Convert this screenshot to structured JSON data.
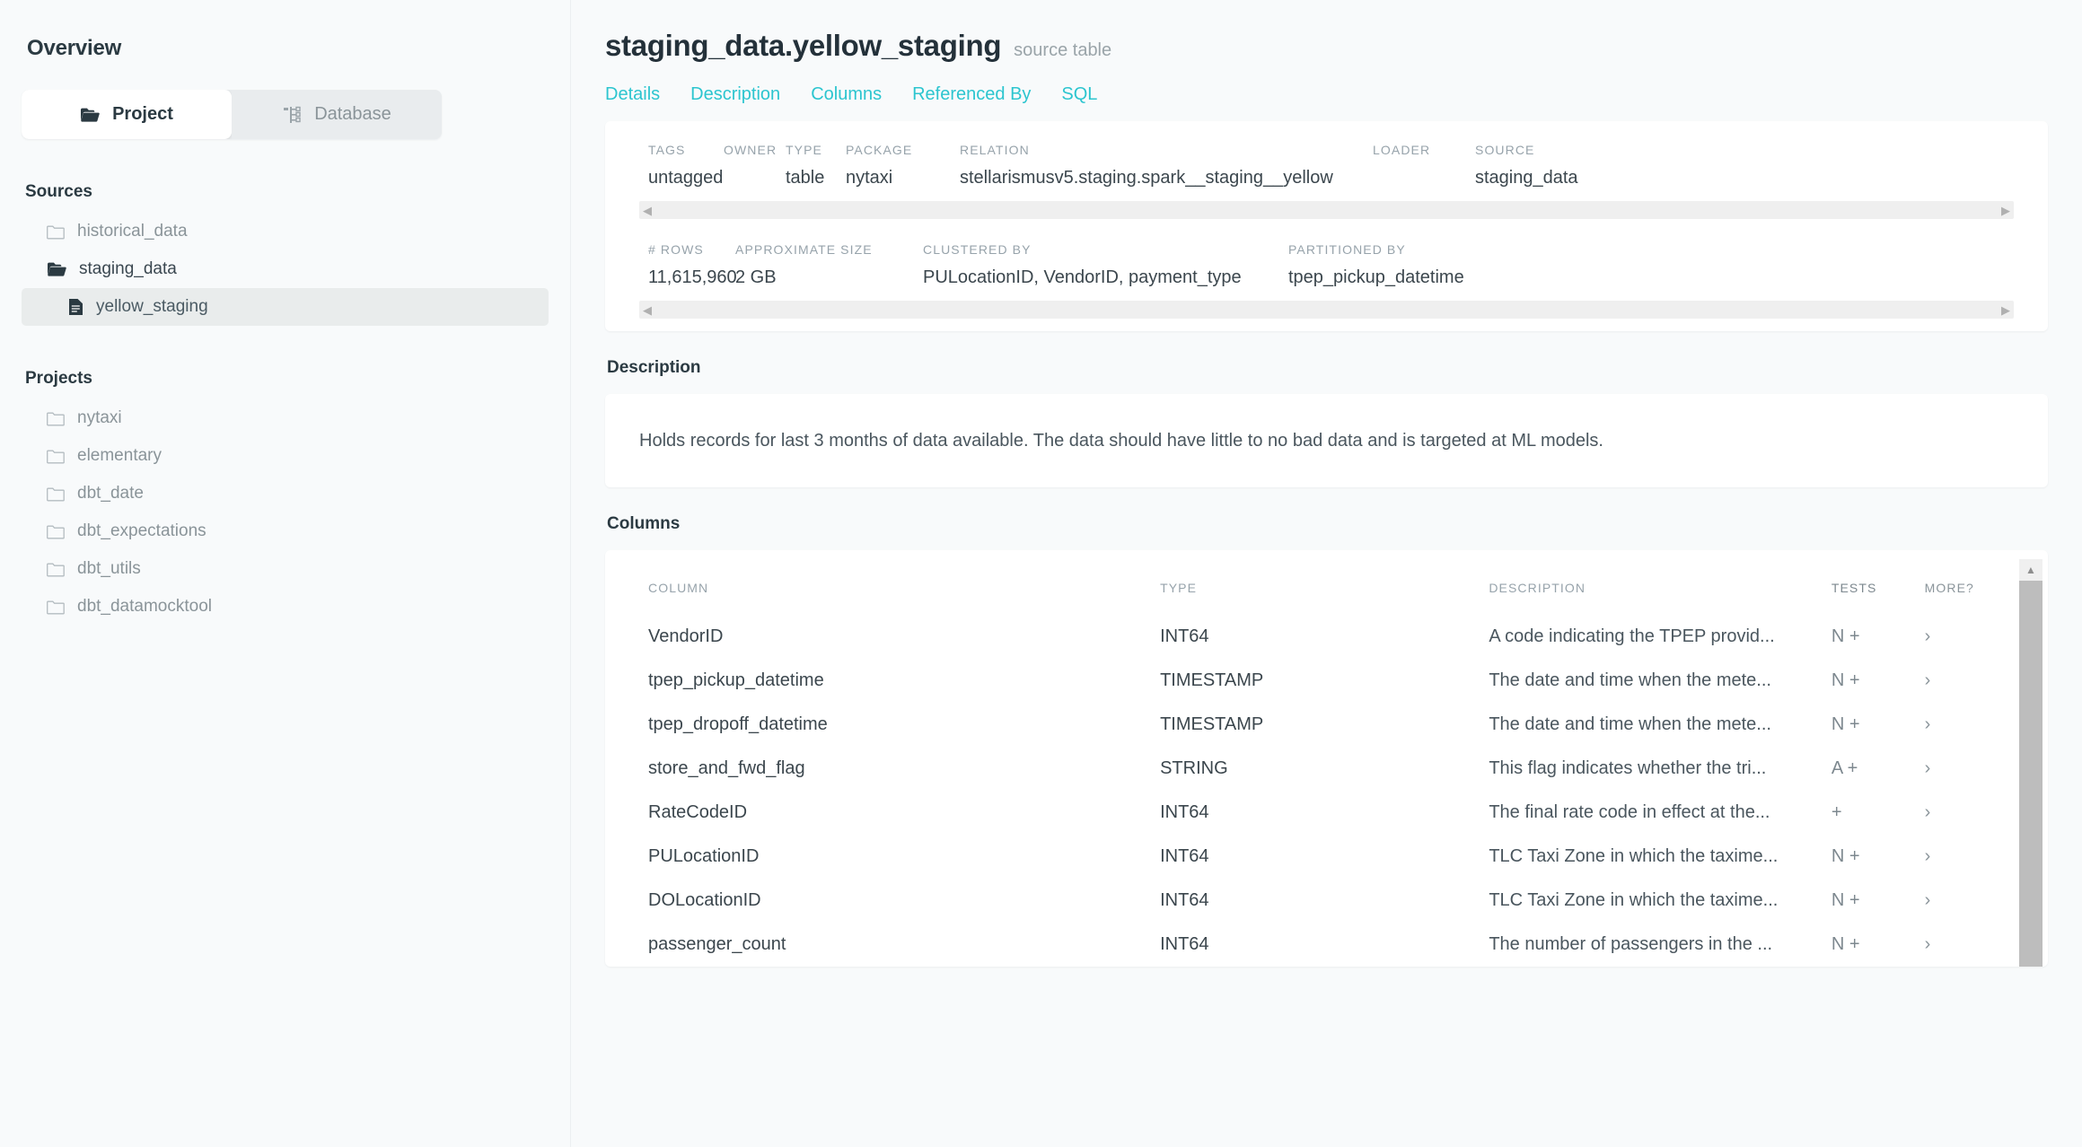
{
  "sidebar": {
    "title": "Overview",
    "switch": [
      {
        "label": "Project",
        "icon": "folder-open-icon",
        "active": true
      },
      {
        "label": "Database",
        "icon": "database-tree-icon",
        "active": false
      }
    ],
    "sources_label": "Sources",
    "sources": [
      {
        "label": "historical_data",
        "icon": "folder-closed-icon",
        "state": "closed"
      },
      {
        "label": "staging_data",
        "icon": "folder-open-icon",
        "state": "open"
      },
      {
        "label": "yellow_staging",
        "icon": "file-icon",
        "state": "selected"
      }
    ],
    "projects_label": "Projects",
    "projects": [
      {
        "label": "nytaxi",
        "icon": "folder-closed-icon"
      },
      {
        "label": "elementary",
        "icon": "folder-closed-icon"
      },
      {
        "label": "dbt_date",
        "icon": "folder-closed-icon"
      },
      {
        "label": "dbt_expectations",
        "icon": "folder-closed-icon"
      },
      {
        "label": "dbt_utils",
        "icon": "folder-closed-icon"
      },
      {
        "label": "dbt_datamocktool",
        "icon": "folder-closed-icon"
      }
    ]
  },
  "header": {
    "title": "staging_data.yellow_staging",
    "subtitle": "source table",
    "tabs": [
      {
        "label": "Details"
      },
      {
        "label": "Description"
      },
      {
        "label": "Columns"
      },
      {
        "label": "Referenced By"
      },
      {
        "label": "SQL"
      }
    ]
  },
  "details": {
    "row1": [
      {
        "key": "TAGS",
        "value": "untagged"
      },
      {
        "key": "OWNER",
        "value": ""
      },
      {
        "key": "TYPE",
        "value": "table"
      },
      {
        "key": "PACKAGE",
        "value": "nytaxi"
      },
      {
        "key": "RELATION",
        "value": "stellarismusv5.staging.spark__staging__yellow"
      },
      {
        "key": "LOADER",
        "value": ""
      },
      {
        "key": "SOURCE",
        "value": "staging_data"
      }
    ],
    "row2": [
      {
        "key": "# ROWS",
        "value": "11,615,960"
      },
      {
        "key": "APPROXIMATE SIZE",
        "value": "2 GB"
      },
      {
        "key": "CLUSTERED BY",
        "value": "PULocationID, VendorID, payment_type"
      },
      {
        "key": "PARTITIONED BY",
        "value": "tpep_pickup_datetime"
      }
    ],
    "scroll_left_icon": "caret-left-icon",
    "scroll_right_icon": "caret-right-icon"
  },
  "description": {
    "heading": "Description",
    "text": "Holds records for last 3 months of data available. The data should have little to no bad data and is targeted at ML models."
  },
  "columns": {
    "heading": "Columns",
    "table_headers": [
      "COLUMN",
      "TYPE",
      "DESCRIPTION",
      "TESTS",
      "MORE?"
    ],
    "rows": [
      {
        "column": "VendorID",
        "type": "INT64",
        "description": "A code indicating the TPEP provid...",
        "tests": "N +",
        "more": "›"
      },
      {
        "column": "tpep_pickup_datetime",
        "type": "TIMESTAMP",
        "description": "The date and time when the mete...",
        "tests": "N +",
        "more": "›"
      },
      {
        "column": "tpep_dropoff_datetime",
        "type": "TIMESTAMP",
        "description": "The date and time when the mete...",
        "tests": "N +",
        "more": "›"
      },
      {
        "column": "store_and_fwd_flag",
        "type": "STRING",
        "description": "This flag indicates whether the tri...",
        "tests": "A +",
        "more": "›"
      },
      {
        "column": "RateCodeID",
        "type": "INT64",
        "description": "The final rate code in effect at the...",
        "tests": "+",
        "more": "›"
      },
      {
        "column": "PULocationID",
        "type": "INT64",
        "description": "TLC Taxi Zone in which the taxime...",
        "tests": "N +",
        "more": "›"
      },
      {
        "column": "DOLocationID",
        "type": "INT64",
        "description": "TLC Taxi Zone in which the taxime...",
        "tests": "N +",
        "more": "›"
      },
      {
        "column": "passenger_count",
        "type": "INT64",
        "description": "The number of passengers in the ...",
        "tests": "N +",
        "more": "›"
      }
    ],
    "scroll_up_icon": "caret-up-icon"
  },
  "colors": {
    "accent": "#2cc5cf",
    "page_bg": "#f8fafb",
    "card_bg": "#ffffff",
    "text": "#3b464d",
    "muted": "#97a3ab"
  }
}
